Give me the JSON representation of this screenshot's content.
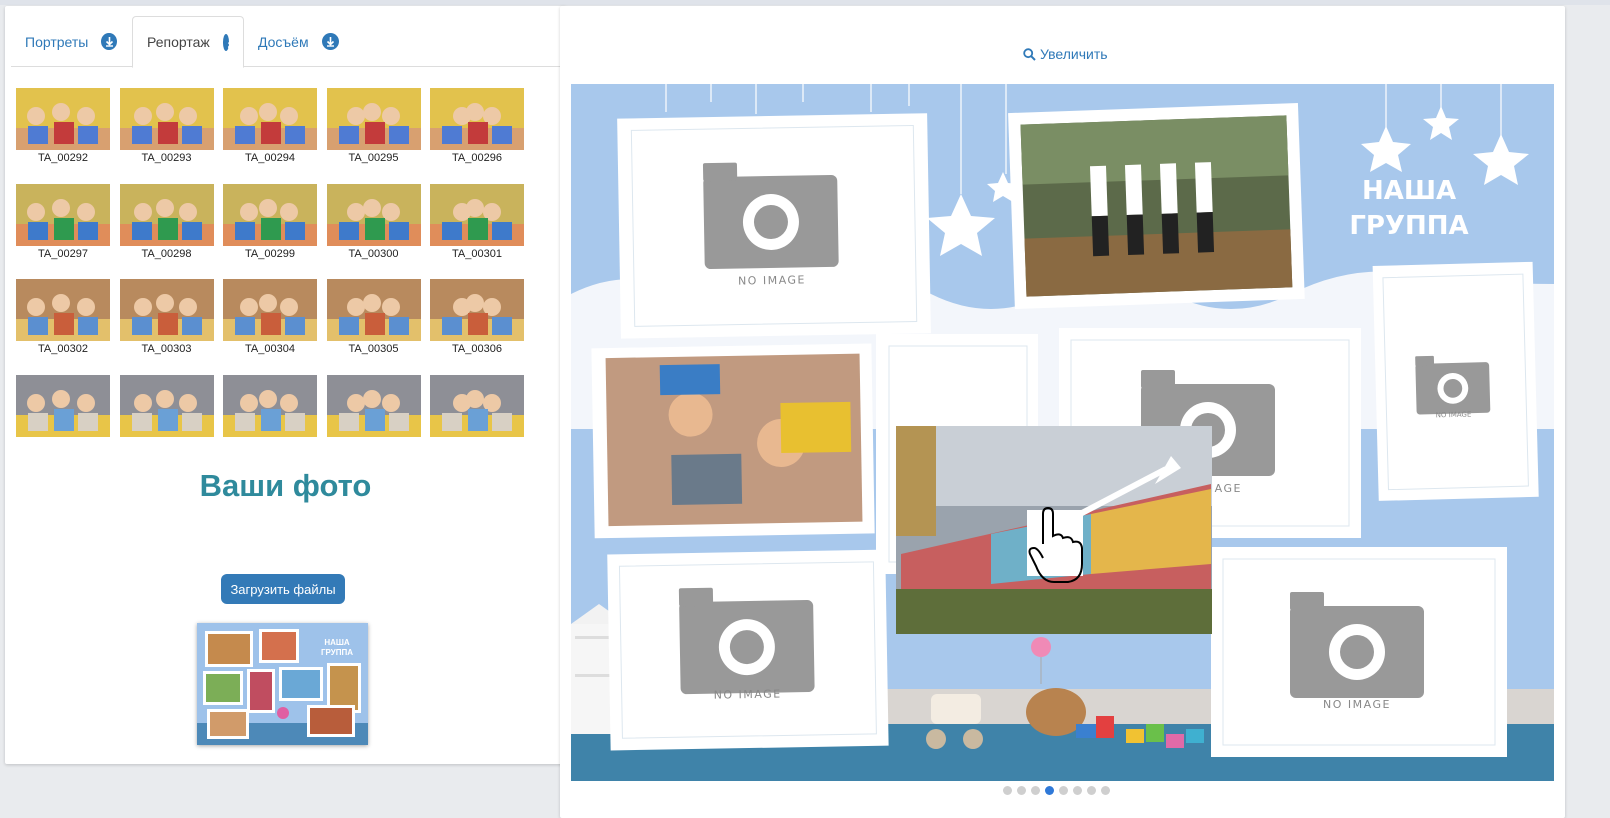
{
  "tabs": [
    {
      "label": "Портреты",
      "active": false
    },
    {
      "label": "Репортаж",
      "active": true
    },
    {
      "label": "Досъём",
      "active": false
    }
  ],
  "gallery": {
    "items": [
      {
        "label": "TA_00292"
      },
      {
        "label": "TA_00293"
      },
      {
        "label": "TA_00294"
      },
      {
        "label": "TA_00295"
      },
      {
        "label": "TA_00296"
      },
      {
        "label": "TA_00297"
      },
      {
        "label": "TA_00298"
      },
      {
        "label": "TA_00299"
      },
      {
        "label": "TA_00300"
      },
      {
        "label": "TA_00301"
      },
      {
        "label": "TA_00302"
      },
      {
        "label": "TA_00303"
      },
      {
        "label": "TA_00304"
      },
      {
        "label": "TA_00305"
      },
      {
        "label": "TA_00306"
      },
      {
        "label": ""
      },
      {
        "label": ""
      },
      {
        "label": ""
      },
      {
        "label": ""
      },
      {
        "label": ""
      }
    ]
  },
  "your_photos_heading": "Ваши фото",
  "upload_button_label": "Загрузить файлы",
  "zoom_label": "Увеличить",
  "layout_title_line1": "НАША",
  "layout_title_line2": "ГРУППА",
  "no_image_label": "NO IMAGE",
  "pagination": {
    "total": 8,
    "active": 4
  },
  "colors": {
    "accent": "#337ab7",
    "heading": "#2f8a9c",
    "layout_bg": "#a8c8ec"
  }
}
